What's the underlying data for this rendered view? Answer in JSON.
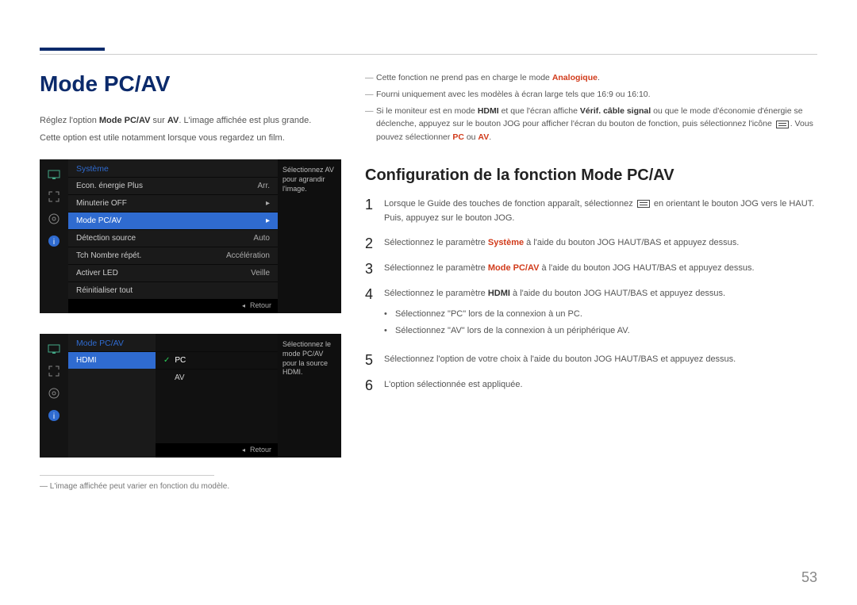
{
  "page_number": "53",
  "page_title": "Mode PC/AV",
  "intro": {
    "line1_pre": "Réglez l'option ",
    "line1_bold": "Mode PC/AV",
    "line1_mid": " sur ",
    "line1_bold2": "AV",
    "line1_post": ". L'image affichée est plus grande.",
    "line2": "Cette option est utile notamment lorsque vous regardez un film."
  },
  "osd1": {
    "title": "Système",
    "tip": "Sélectionnez AV pour agrandir l'image.",
    "footer": "Retour",
    "items": [
      {
        "label": "Econ. énergie Plus",
        "value": "Arr."
      },
      {
        "label": "Minuterie OFF",
        "value": "▸"
      },
      {
        "label": "Mode PC/AV",
        "value": "▸",
        "selected": true
      },
      {
        "label": "Détection source",
        "value": "Auto"
      },
      {
        "label": "Tch Nombre répét.",
        "value": "Accélération"
      },
      {
        "label": "Activer LED",
        "value": "Veille"
      },
      {
        "label": "Réinitialiser tout",
        "value": ""
      }
    ]
  },
  "osd2": {
    "title": "Mode PC/AV",
    "left_item": "HDMI",
    "tip": "Sélectionnez le mode PC/AV pour la source HDMI.",
    "footer": "Retour",
    "options": [
      {
        "label": "PC",
        "selected": true
      },
      {
        "label": "AV"
      }
    ]
  },
  "footnote": "L'image affichée peut varier en fonction du modèle.",
  "right_notes": [
    {
      "pre": "Cette fonction ne prend pas en charge le mode ",
      "red": "Analogique",
      "post": "."
    },
    {
      "plain": "Fourni uniquement avec les modèles à écran large tels que 16:9 ou 16:10."
    },
    {
      "pre": "Si le moniteur est en mode ",
      "bold1": "HDMI",
      "mid1": " et que l'écran affiche ",
      "bold2": "Vérif. câble signal",
      "mid2": " ou que le mode d'économie d'énergie se déclenche, appuyez sur le bouton JOG pour afficher l'écran du bouton de fonction, puis sélectionnez l'icône ",
      "glyph": true,
      "mid3": ". Vous pouvez sélectionner ",
      "red1": "PC",
      "mid4": " ou ",
      "red2": "AV",
      "post": "."
    }
  ],
  "subheading": "Configuration de la fonction Mode PC/AV",
  "steps": [
    {
      "n": "1",
      "pre": "Lorsque le Guide des touches de fonction apparaît, sélectionnez ",
      "glyph": true,
      "post": " en orientant le bouton JOG vers le HAUT. Puis, appuyez sur le bouton JOG."
    },
    {
      "n": "2",
      "pre": "Sélectionnez le paramètre ",
      "red": "Système",
      "post": " à l'aide du bouton JOG HAUT/BAS et appuyez dessus."
    },
    {
      "n": "3",
      "pre": "Sélectionnez le paramètre ",
      "red": "Mode PC/AV",
      "post": " à l'aide du bouton JOG HAUT/BAS et appuyez dessus."
    },
    {
      "n": "4",
      "pre": "Sélectionnez le paramètre ",
      "bold": "HDMI",
      "post": " à l'aide du bouton JOG HAUT/BAS et appuyez dessus.",
      "bullets": [
        "Sélectionnez \"PC\" lors de la connexion à un PC.",
        "Sélectionnez \"AV\" lors de la connexion à un périphérique AV."
      ]
    },
    {
      "n": "5",
      "plain": "Sélectionnez l'option de votre choix à l'aide du bouton JOG HAUT/BAS et appuyez dessus."
    },
    {
      "n": "6",
      "plain": "L'option sélectionnée est appliquée."
    }
  ]
}
